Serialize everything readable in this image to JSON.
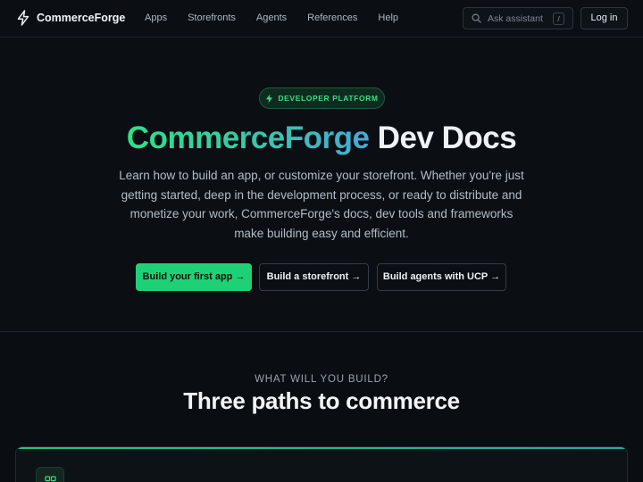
{
  "brand": {
    "name": "CommerceForge",
    "icon": "lightning-bolt-icon"
  },
  "nav": {
    "links": [
      {
        "label": "Apps"
      },
      {
        "label": "Storefronts"
      },
      {
        "label": "Agents"
      },
      {
        "label": "References"
      },
      {
        "label": "Help"
      }
    ],
    "search": {
      "placeholder": "Ask assistant",
      "shortcut": "/"
    },
    "login_label": "Log in"
  },
  "hero": {
    "badge": "DEVELOPER PLATFORM",
    "title_gradient": "CommerceForge",
    "title_plain": " Dev Docs",
    "description": "Learn how to build an app, or customize your storefront. Whether you're just getting started, deep in the development process, or ready to distribute and monetize your work, CommerceForge's docs, dev tools and frameworks make building easy and efficient.",
    "ctas": [
      {
        "label": "Build your first app →",
        "style": "primary"
      },
      {
        "label": "Build a storefront →",
        "style": "secondary"
      },
      {
        "label": "Build agents with UCP →",
        "style": "secondary"
      }
    ]
  },
  "section": {
    "eyebrow": "WHAT WILL YOU BUILD?",
    "title": "Three paths to commerce",
    "card_icon": "grid-icon"
  },
  "colors": {
    "background": "#0b0f14",
    "accent_green": "#1fd176",
    "gradient_start": "#2ee08a",
    "gradient_end": "#49a9d6"
  }
}
